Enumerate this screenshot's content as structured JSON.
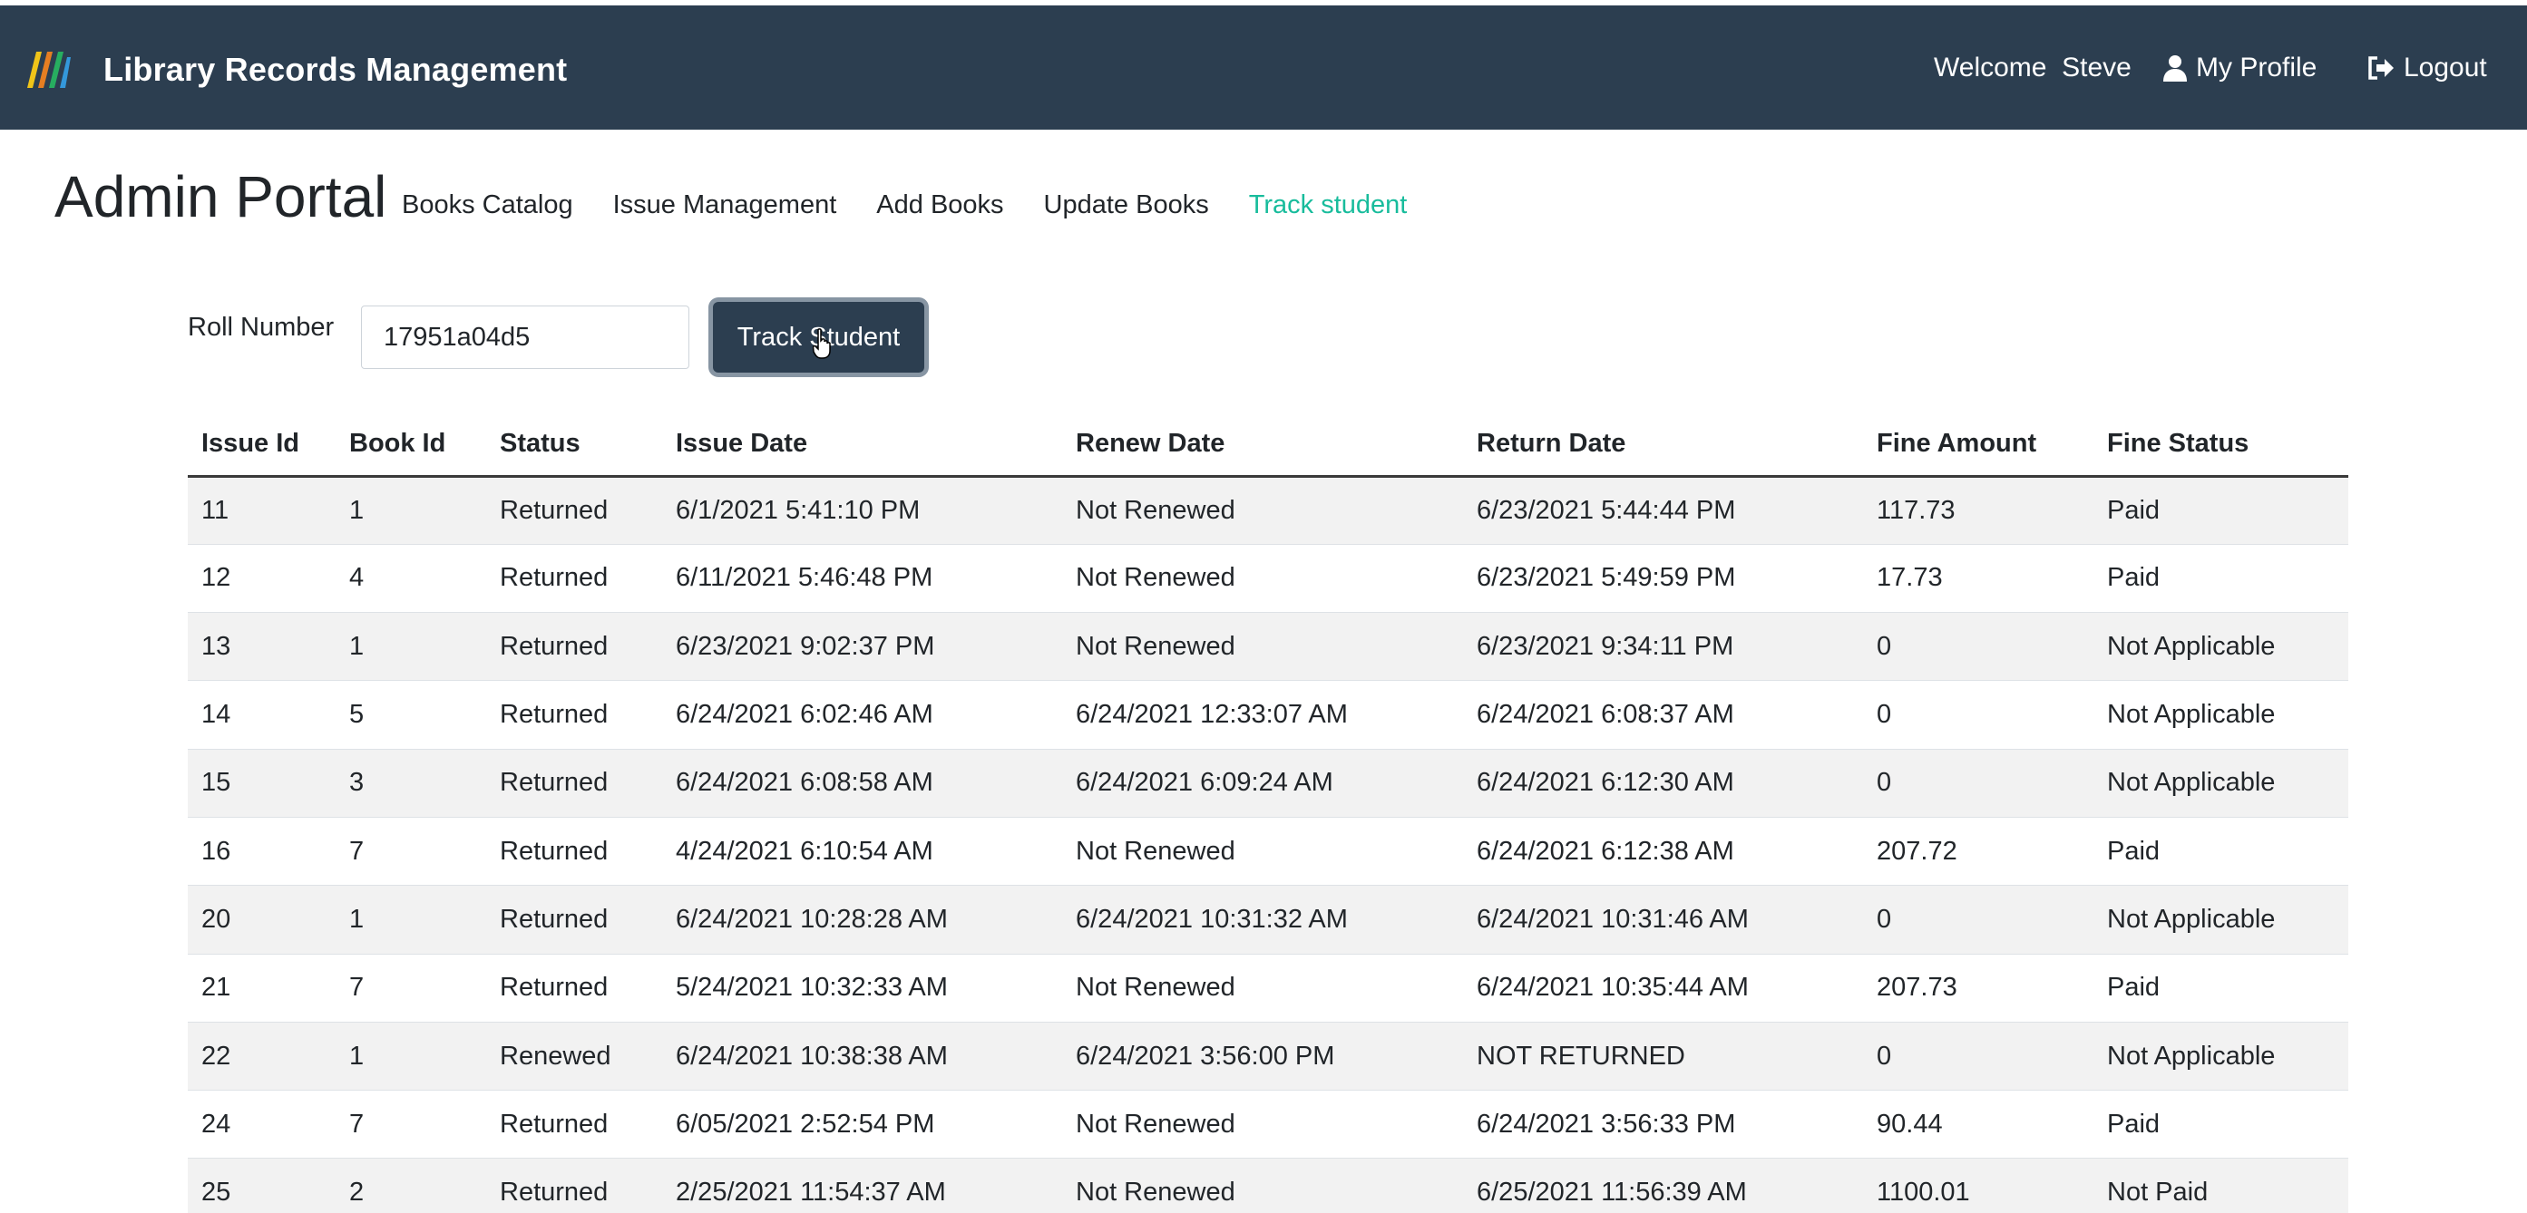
{
  "app": {
    "title": "Library Records Management",
    "welcome": "Welcome  Steve",
    "profile_label": "My Profile",
    "logout_label": "Logout"
  },
  "portal": {
    "title": "Admin Portal",
    "tabs": [
      {
        "label": "Books Catalog",
        "active": false
      },
      {
        "label": "Issue Management",
        "active": false
      },
      {
        "label": "Add Books",
        "active": false
      },
      {
        "label": "Update Books",
        "active": false
      },
      {
        "label": "Track student",
        "active": true
      }
    ]
  },
  "search": {
    "label": "Roll Number",
    "value": "17951a04d5",
    "button_label": "Track Student"
  },
  "table": {
    "columns": [
      "Issue Id",
      "Book Id",
      "Status",
      "Issue Date",
      "Renew Date",
      "Return Date",
      "Fine Amount",
      "Fine Status"
    ],
    "rows": [
      [
        "11",
        "1",
        "Returned",
        "6/1/2021 5:41:10 PM",
        "Not Renewed",
        "6/23/2021 5:44:44 PM",
        "117.73",
        "Paid"
      ],
      [
        "12",
        "4",
        "Returned",
        "6/11/2021 5:46:48 PM",
        "Not Renewed",
        "6/23/2021 5:49:59 PM",
        "17.73",
        "Paid"
      ],
      [
        "13",
        "1",
        "Returned",
        "6/23/2021 9:02:37 PM",
        "Not Renewed",
        "6/23/2021 9:34:11 PM",
        "0",
        "Not Applicable"
      ],
      [
        "14",
        "5",
        "Returned",
        "6/24/2021 6:02:46 AM",
        "6/24/2021 12:33:07 AM",
        "6/24/2021 6:08:37 AM",
        "0",
        "Not Applicable"
      ],
      [
        "15",
        "3",
        "Returned",
        "6/24/2021 6:08:58 AM",
        "6/24/2021 6:09:24 AM",
        "6/24/2021 6:12:30 AM",
        "0",
        "Not Applicable"
      ],
      [
        "16",
        "7",
        "Returned",
        "4/24/2021 6:10:54 AM",
        "Not Renewed",
        "6/24/2021 6:12:38 AM",
        "207.72",
        "Paid"
      ],
      [
        "20",
        "1",
        "Returned",
        "6/24/2021 10:28:28 AM",
        "6/24/2021 10:31:32 AM",
        "6/24/2021 10:31:46 AM",
        "0",
        "Not Applicable"
      ],
      [
        "21",
        "7",
        "Returned",
        "5/24/2021 10:32:33 AM",
        "Not Renewed",
        "6/24/2021 10:35:44 AM",
        "207.73",
        "Paid"
      ],
      [
        "22",
        "1",
        "Renewed",
        "6/24/2021 10:38:38 AM",
        "6/24/2021 3:56:00 PM",
        "NOT RETURNED",
        "0",
        "Not Applicable"
      ],
      [
        "24",
        "7",
        "Returned",
        "6/05/2021 2:52:54 PM",
        "Not Renewed",
        "6/24/2021 3:56:33 PM",
        "90.44",
        "Paid"
      ],
      [
        "25",
        "2",
        "Returned",
        "2/25/2021 11:54:37 AM",
        "Not Renewed",
        "6/25/2021 11:56:39 AM",
        "1100.01",
        "Not Paid"
      ]
    ]
  },
  "colors": {
    "navbar": "#2c3e50",
    "active_tab": "#18bc9c",
    "button": "#2c3e50"
  },
  "icons": {
    "brand": "books-icon",
    "profile": "user-icon",
    "logout": "sign-out-icon"
  }
}
